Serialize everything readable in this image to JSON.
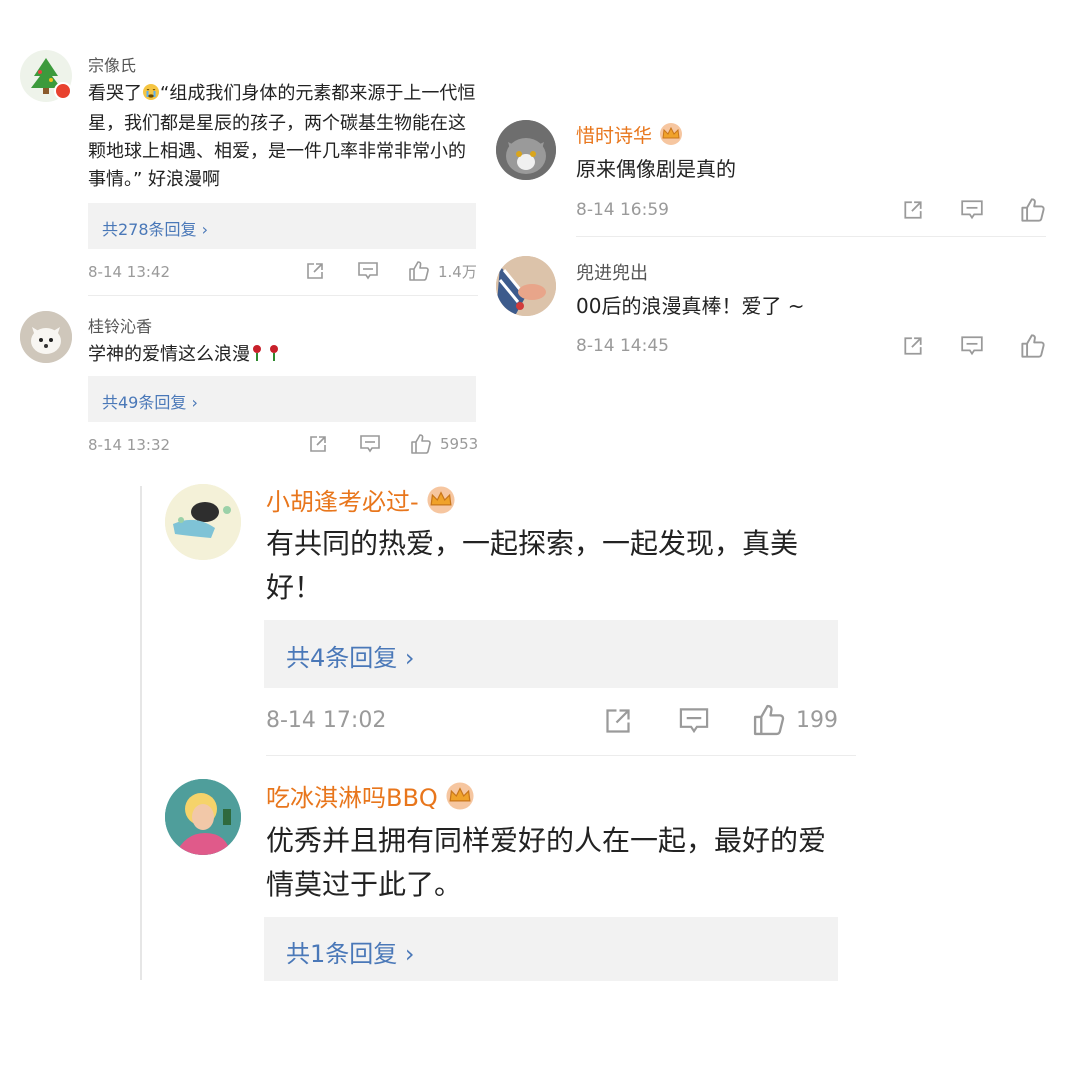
{
  "comments": [
    {
      "user": "宗像氏",
      "text_before": "看哭了",
      "emoji": "crying-face",
      "text_after": "“组成我们身体的元素都来源于上一代恒星，我们都是星辰的孩子，两个碳基生物能在这颗地球上相遇、相爱，是一件几率非常非常小的事情。” 好浪漫啊",
      "reply_count": "共278条回复 ›",
      "date": "8-14 13:42",
      "likes": "1.4万"
    },
    {
      "user": "桂铃沁香",
      "text": "学神的爱情这么浪漫",
      "emoji": "rose",
      "reply_count": "共49条回复 ›",
      "date": "8-14 13:32",
      "likes": "5953"
    },
    {
      "user": "惜时诗华",
      "badge": "crown-badge",
      "text": "原来偶像剧是真的",
      "date": "8-14 16:59"
    },
    {
      "user": "兜进兜出",
      "text": "00后的浪漫真棒！爱了 ~",
      "date": "8-14 14:45"
    },
    {
      "user": "小胡逢考必过-",
      "badge": "crown-badge",
      "text": "有共同的热爱，一起探索，一起发现，真美好！",
      "reply_count": "共4条回复 ›",
      "date": "8-14 17:02",
      "likes": "199"
    },
    {
      "user": "吃冰淇淋吗BBQ",
      "badge": "crown-badge",
      "text": "优秀并且拥有同样爱好的人在一起，最好的爱情莫过于此了。",
      "reply_count": "共1条回复 ›"
    }
  ],
  "icons": {
    "share": "share-icon",
    "comment": "comment-icon",
    "like": "thumbs-up-icon",
    "crown": "crown-badge-icon"
  },
  "colors": {
    "vip_name": "#e8761c",
    "reply_link": "#4a78b8",
    "meta": "#9a9a9a",
    "reply_bg": "#f2f2f2"
  }
}
